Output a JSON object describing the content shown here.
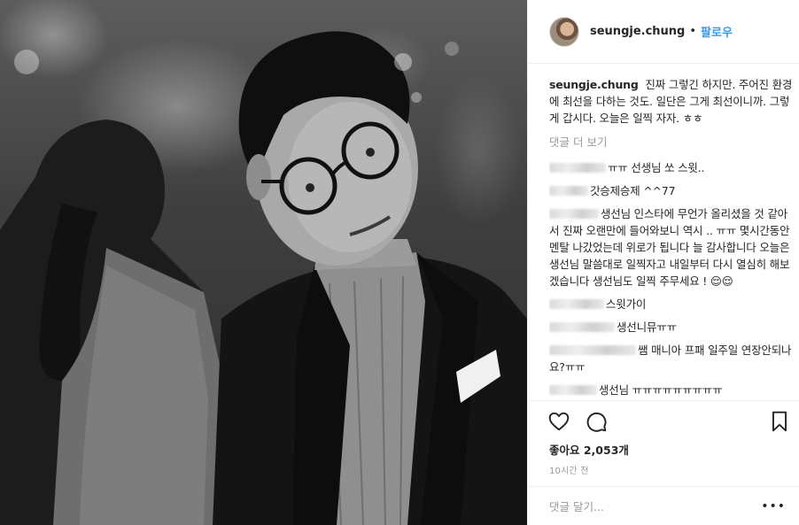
{
  "post": {
    "username": "seungje.chung",
    "separator": "•",
    "follow_label": "팔로우",
    "caption": {
      "user": "seungje.chung",
      "text": "진짜 그렇긴 하지만. 주어진 환경에 최선을 다하는 것도. 일단은 그게 최선이니까. 그렇게 갑시다. 오늘은 일찍 자자. ㅎㅎ"
    },
    "view_more_label": "댓글 더 보기",
    "comments": [
      {
        "text": "ㅠㅠ 선생님 쏘 스윗.."
      },
      {
        "text": "갓승제승제 ^^77"
      },
      {
        "text": "생선님 인스타에 무언가 올리셨을 것 같아서 진짜 오랜만에 들어와보니 역시 .. ㅠㅠ 몇시간동안 멘탈 나갔었는데 위로가 됩니다 늘 감사합니다 오늘은 생선님 말씀대로 일찍자고 내일부터 다시 열심히 해보겠습니다 생선님도 일찍 주무세요 ! 😌😌"
      },
      {
        "text": "스윗가이"
      },
      {
        "text": "생선니뮤ㅠㅠ"
      },
      {
        "text": "쌤 매니아 프패 일주일 연장안되나요?ㅠㅠ"
      },
      {
        "text": "생선님 ㅠㅠㅠㅠㅠㅠㅠㅠㅠ"
      }
    ],
    "likes_label": "좋아요 2,053개",
    "time_label": "10시간 전",
    "comment_placeholder": "댓글 달기...",
    "options_label": "•••"
  },
  "icons": {
    "like": "heart-icon",
    "comment": "comment-bubble-icon",
    "save": "bookmark-icon",
    "options": "more-options-icon"
  },
  "colors": {
    "link": "#3897f0",
    "text": "#262626",
    "muted": "#999999",
    "divider": "#efefef"
  }
}
